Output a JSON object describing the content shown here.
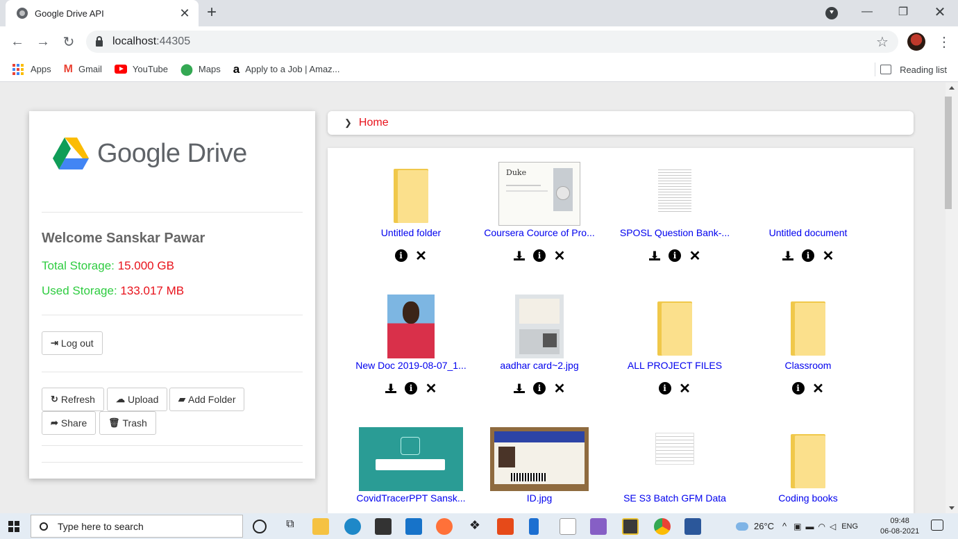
{
  "browser": {
    "tab_title": "Google Drive API",
    "url_host": "localhost",
    "url_port": ":44305",
    "bookmarks": [
      "Apps",
      "Gmail",
      "YouTube",
      "Maps",
      "Apply to a Job | Amaz..."
    ],
    "reading_list": "Reading list"
  },
  "sidebar": {
    "logo_text": "Google Drive",
    "welcome": "Welcome Sanskar Pawar",
    "total_label": "Total Storage: ",
    "total_value": "15.000 GB",
    "used_label": "Used Storage: ",
    "used_value": "133.017 MB",
    "logout": "Log out",
    "refresh": "Refresh",
    "upload": "Upload",
    "add_folder": "Add Folder",
    "share": "Share",
    "trash": "Trash"
  },
  "breadcrumb": {
    "home": "Home"
  },
  "files": [
    {
      "name": "Untitled folder",
      "type": "folder",
      "download": false
    },
    {
      "name": "Coursera Cource of Pro...",
      "type": "certificate",
      "download": true
    },
    {
      "name": "SPOSL Question Bank-...",
      "type": "document",
      "download": true
    },
    {
      "name": "Untitled document",
      "type": "blank",
      "download": true
    },
    {
      "name": "New Doc 2019-08-07_1...",
      "type": "photo",
      "download": true
    },
    {
      "name": "aadhar card~2.jpg",
      "type": "idcard",
      "download": true
    },
    {
      "name": "ALL PROJECT FILES",
      "type": "folder",
      "download": false
    },
    {
      "name": "Classroom",
      "type": "folder",
      "download": false
    },
    {
      "name": "CovidTracerPPT Sansk...",
      "type": "slides",
      "download": true
    },
    {
      "name": "ID.jpg",
      "type": "idphoto",
      "download": true
    },
    {
      "name": "SE S3 Batch GFM Data",
      "type": "sheet",
      "download": true
    },
    {
      "name": "Coding books",
      "type": "folder",
      "download": false
    }
  ],
  "taskbar": {
    "search_placeholder": "Type here to search",
    "weather": "26°C",
    "lang": "ENG",
    "time": "09:48",
    "date": "06-08-2021"
  },
  "colors": {
    "storage_label": "#2ecc40",
    "storage_value": "#e8121b",
    "link": "#0000ee"
  }
}
